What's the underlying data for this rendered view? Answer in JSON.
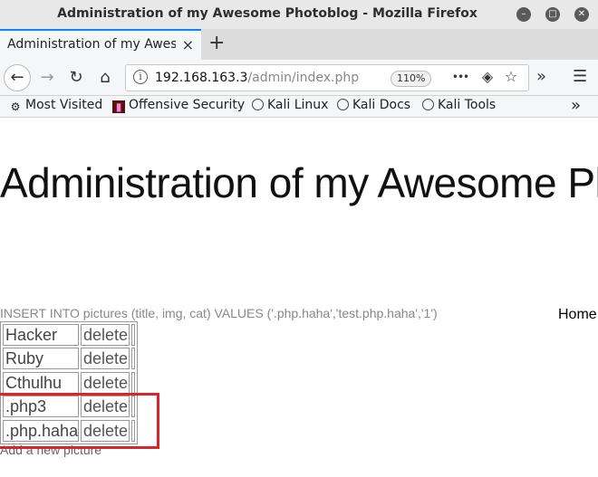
{
  "window": {
    "title": "Administration of my Awesome Photoblog - Mozilla Firefox",
    "buttons": {
      "minimize": "–",
      "maximize": "□",
      "close": "✕"
    }
  },
  "tabs": [
    {
      "label": "Administration of my Awesome Photoblog",
      "close": "×"
    }
  ],
  "new_tab": "+",
  "navbar": {
    "back": "←",
    "forward": "→",
    "reload": "↻",
    "home": "⌂",
    "url_host": "192.168.163.3",
    "url_path": "/admin/index.php",
    "zoom": "110%",
    "more": "•••",
    "pocket": "◈",
    "bookmark_star": "☆",
    "overflow": "»",
    "menu": "☰"
  },
  "bookmarks": {
    "items": [
      {
        "label": "Most Visited",
        "icon": "gear-icon"
      },
      {
        "label": "Offensive Security",
        "icon": "offsec-icon"
      },
      {
        "label": "Kali Linux",
        "icon": "globe-icon"
      },
      {
        "label": "Kali Docs",
        "icon": "globe-icon"
      },
      {
        "label": "Kali Tools",
        "icon": "globe-icon"
      }
    ],
    "overflow": "»"
  },
  "page": {
    "heading": "Administration of my Awesome Photoblog",
    "home_link": "Home",
    "sql_message": "INSERT INTO pictures (title, img, cat) VALUES ('.php.haha','test.php.haha','1')",
    "pictures": [
      {
        "title": "Hacker",
        "action": "delete"
      },
      {
        "title": "Ruby",
        "action": "delete"
      },
      {
        "title": "Cthulhu",
        "action": "delete"
      },
      {
        "title": ".php3",
        "action": "delete"
      },
      {
        "title": ".php.haha",
        "action": "delete"
      }
    ],
    "add_link": "Add a new picture"
  },
  "colors": {
    "highlight_box": "#d9232d",
    "tab_accent": "#0a84ff"
  }
}
